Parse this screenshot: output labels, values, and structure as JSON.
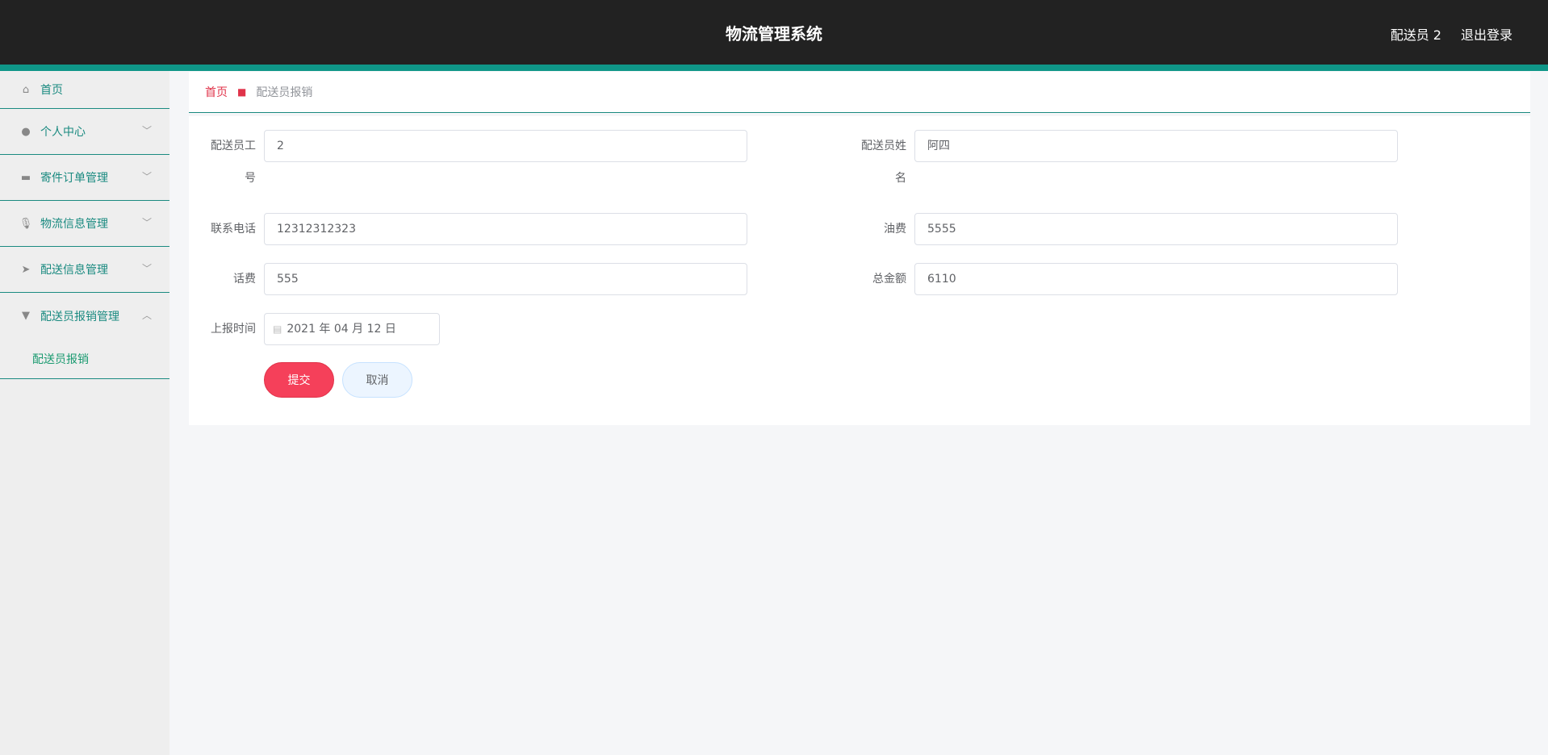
{
  "header": {
    "title": "物流管理系统",
    "user": "配送员 2",
    "logout": "退出登录"
  },
  "sidebar": {
    "items": [
      {
        "label": "首页",
        "icon": "home-icon"
      },
      {
        "label": "个人中心",
        "icon": "user-icon"
      },
      {
        "label": "寄件订单管理",
        "icon": "chat-icon"
      },
      {
        "label": "物流信息管理",
        "icon": "microphone-icon"
      },
      {
        "label": "配送信息管理",
        "icon": "send-icon"
      },
      {
        "label": "配送员报销管理",
        "icon": "brush-icon"
      }
    ],
    "sub": "配送员报销"
  },
  "breadcrumb": {
    "home": "首页",
    "current": "配送员报销"
  },
  "form": {
    "id_label_1": "配送员工",
    "id_label_2": "号",
    "id_value": "2",
    "name_label_1": "配送员姓",
    "name_label_2": "名",
    "name_value": "阿四",
    "phone_label": "联系电话",
    "phone_value": "12312312323",
    "fuel_label": "油费",
    "fuel_value": "5555",
    "tel_fee_label": "话费",
    "tel_fee_value": "555",
    "total_label": "总金额",
    "total_value": "6110",
    "date_label": "上报时间",
    "date_value": "2021 年 04 月 12 日",
    "submit": "提交",
    "cancel": "取消"
  }
}
